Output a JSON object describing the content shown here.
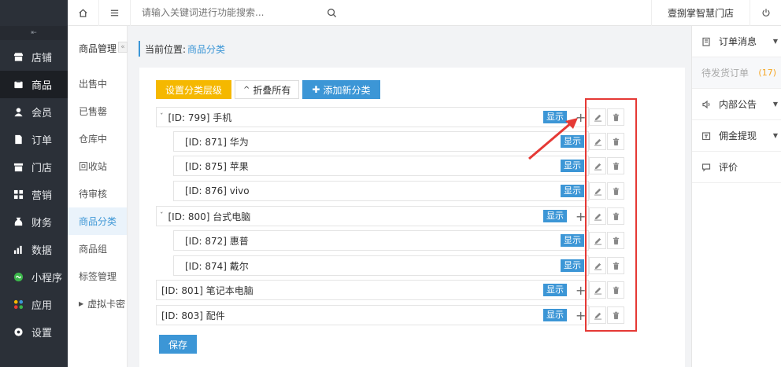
{
  "sidebar": {
    "collapse_glyph": "⇤",
    "items": [
      {
        "label": "店铺",
        "icon": "store-icon"
      },
      {
        "label": "商品",
        "icon": "goods-icon",
        "active": true
      },
      {
        "label": "会员",
        "icon": "member-icon"
      },
      {
        "label": "订单",
        "icon": "order-icon"
      },
      {
        "label": "门店",
        "icon": "shop-icon"
      },
      {
        "label": "营销",
        "icon": "marketing-icon"
      },
      {
        "label": "财务",
        "icon": "finance-icon"
      },
      {
        "label": "数据",
        "icon": "data-icon"
      },
      {
        "label": "小程序",
        "icon": "miniapp-icon"
      },
      {
        "label": "应用",
        "icon": "apps-icon"
      },
      {
        "label": "设置",
        "icon": "settings-icon"
      }
    ]
  },
  "subsidebar": {
    "title": "商品管理",
    "collapse_glyph": "«",
    "items": [
      {
        "label": "出售中"
      },
      {
        "label": "已售罄"
      },
      {
        "label": "仓库中"
      },
      {
        "label": "回收站"
      },
      {
        "label": "待审核"
      },
      {
        "label": "商品分类",
        "active": true
      },
      {
        "label": "商品组"
      },
      {
        "label": "标签管理"
      },
      {
        "label": "虚拟卡密",
        "has_caret": true
      }
    ]
  },
  "topbar": {
    "search_placeholder": "请输入关键词进行功能搜索...",
    "store_name": "壹捌掌智慧门店"
  },
  "breadcrumb": {
    "label": "当前位置:",
    "current": "商品分类"
  },
  "toolbar": {
    "set_level": "设置分类层级",
    "collapse_all": "折叠所有",
    "collapse_glyph": "^",
    "add_new": "添加新分类",
    "add_glyph": "✚"
  },
  "tree": [
    {
      "text": "[ID: 799] 手机",
      "level": 0,
      "expanded": true,
      "badge": "显示"
    },
    {
      "text": "[ID: 871] 华为",
      "level": 1,
      "badge": "显示"
    },
    {
      "text": "[ID: 875] 苹果",
      "level": 1,
      "badge": "显示"
    },
    {
      "text": "[ID: 876] vivo",
      "level": 1,
      "badge": "显示"
    },
    {
      "text": "[ID: 800] 台式电脑",
      "level": 0,
      "expanded": true,
      "badge": "显示"
    },
    {
      "text": "[ID: 872] 惠普",
      "level": 1,
      "badge": "显示"
    },
    {
      "text": "[ID: 874] 戴尔",
      "level": 1,
      "badge": "显示"
    },
    {
      "text": "[ID: 801] 笔记本电脑",
      "level": 0,
      "badge": "显示"
    },
    {
      "text": "[ID: 803] 配件",
      "level": 0,
      "badge": "显示"
    }
  ],
  "tree_glyphs": {
    "caret": "ˇ",
    "plus": "+"
  },
  "save_label": "保存",
  "rightbar": {
    "order_msg": "订单消息",
    "pending_label": "待发货订单",
    "pending_count": "(17)",
    "notice": "内部公告",
    "commission": "佣金提现",
    "review": "评价"
  },
  "colors": {
    "accent": "#3c96d6",
    "warning": "#f5b800",
    "annotation": "#e53935",
    "sidebar_bg": "#2b3038"
  }
}
